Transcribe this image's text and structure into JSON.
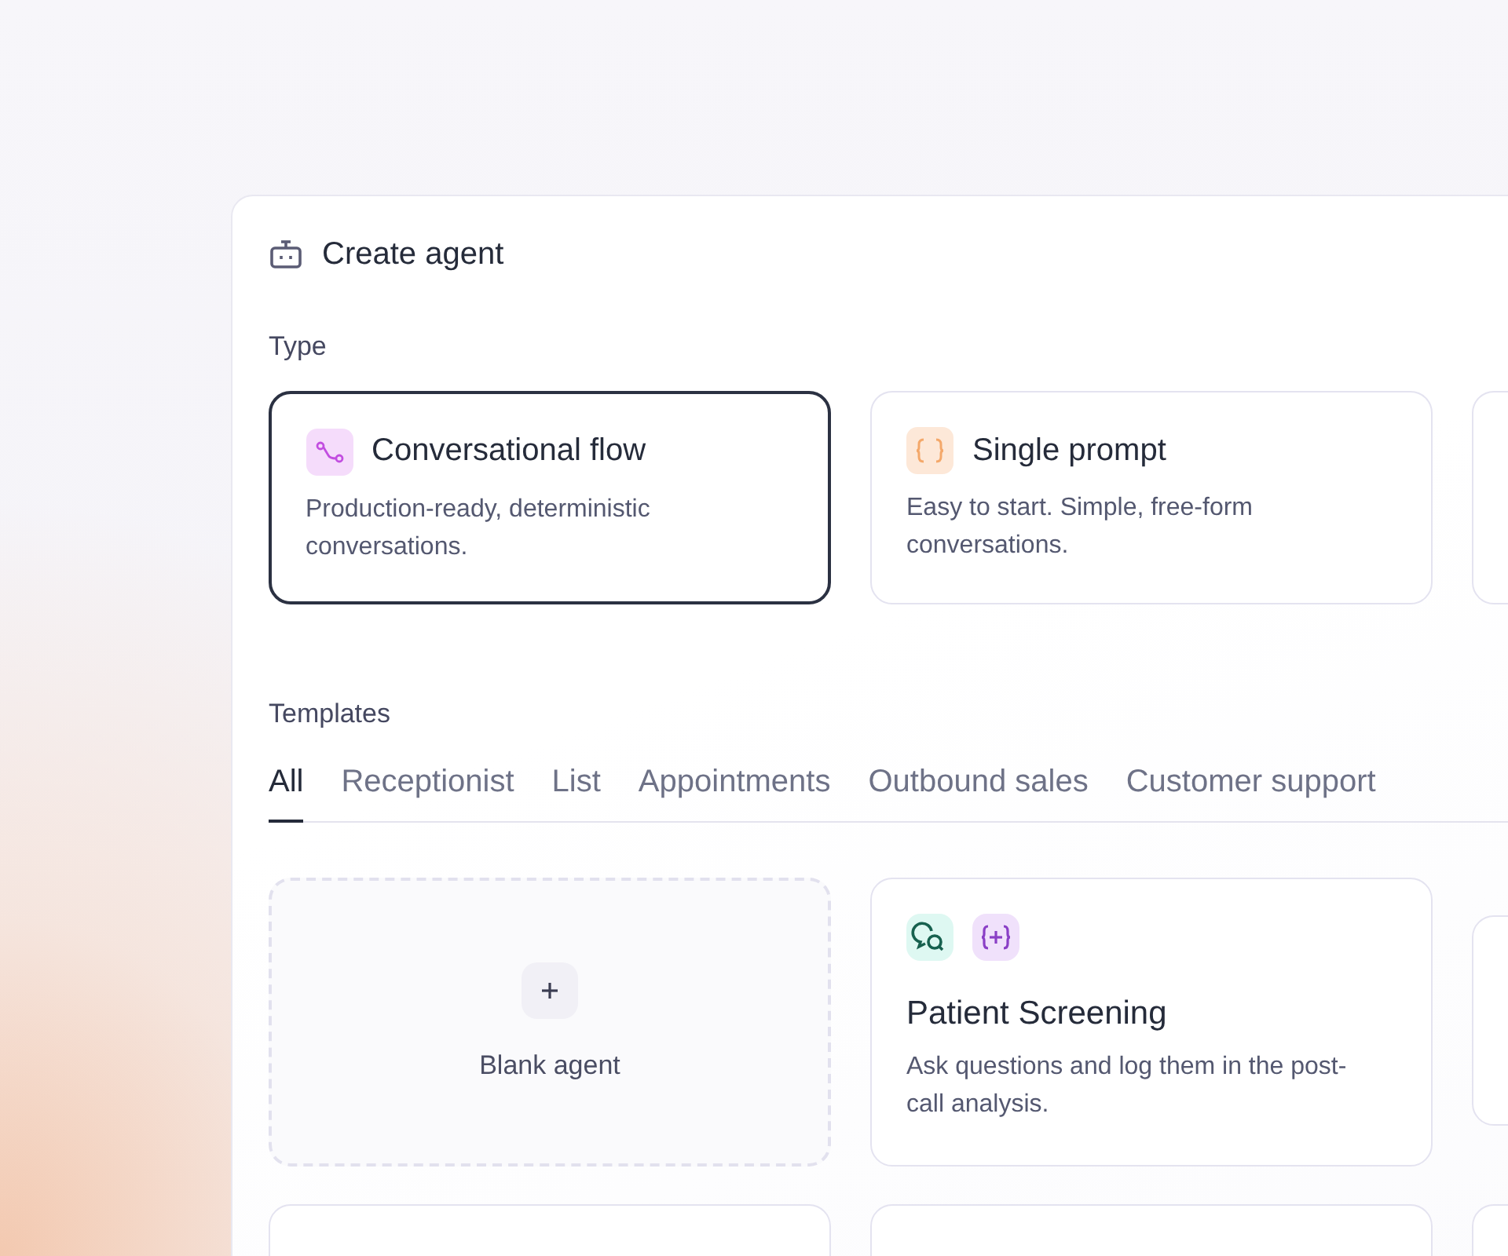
{
  "header": {
    "title": "Create agent"
  },
  "type_section": {
    "label": "Type",
    "options": [
      {
        "kind": "flow",
        "title": "Conversational flow",
        "description": "Production-ready, deterministic conversations.",
        "selected": true
      },
      {
        "kind": "prompt",
        "title": "Single prompt",
        "description": "Easy to start. Simple, free-form conversations.",
        "selected": false
      },
      {
        "kind": "cut",
        "selected": false
      }
    ]
  },
  "templates": {
    "label": "Templates",
    "tabs": [
      {
        "label": "All",
        "selected": true
      },
      {
        "label": "Receptionist",
        "selected": false
      },
      {
        "label": "List",
        "selected": false
      },
      {
        "label": "Appointments",
        "selected": false
      },
      {
        "label": "Outbound sales",
        "selected": false
      },
      {
        "label": "Customer support",
        "selected": false
      }
    ],
    "cards": [
      {
        "kind": "blank",
        "title": "Blank agent"
      },
      {
        "kind": "template",
        "title": "Patient Screening",
        "description": "Ask questions and log them in the post-call analysis."
      },
      {
        "kind": "cut-template"
      },
      {
        "kind": "cut"
      },
      {
        "kind": "cut"
      },
      {
        "kind": "cut"
      }
    ]
  }
}
